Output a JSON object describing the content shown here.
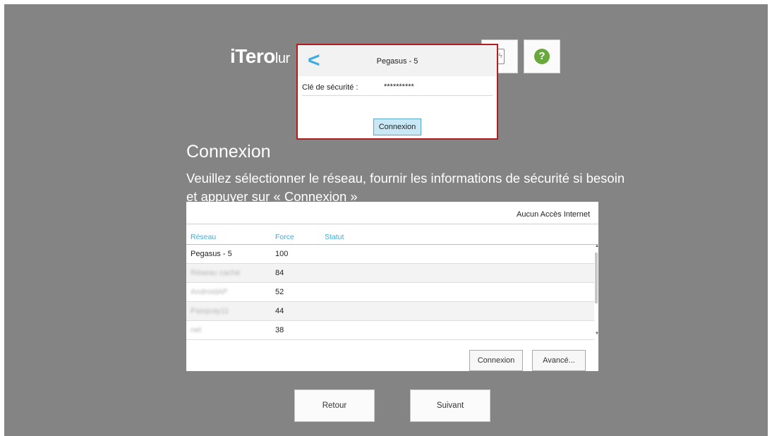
{
  "header": {
    "logo_text": "iTero",
    "logo_suffix": "lur",
    "plug_icon": "plug-icon",
    "help_icon": "question-icon",
    "help_glyph": "?",
    "help_color": "#69a83a"
  },
  "popup": {
    "network_name": "Pegasus - 5",
    "key_label": "Clé de sécurité :",
    "key_value": "**********",
    "connect_label": "Connexion",
    "border_color": "#b01e1e",
    "accent_color": "#3aaee0"
  },
  "main": {
    "title": "Connexion",
    "subtitle": "Veuillez sélectionner le réseau, fournir les informations de sécurité si besoin et appuyer sur « Connexion »"
  },
  "network_panel": {
    "internet_status": "Aucun Accès Internet",
    "columns": [
      "Réseau",
      "Force",
      "Statut"
    ],
    "rows": [
      {
        "name": "Pegasus - 5",
        "force": "100",
        "status": ""
      },
      {
        "name": "Réseau caché",
        "force": "84",
        "status": ""
      },
      {
        "name": "AndroidAP",
        "force": "52",
        "status": ""
      },
      {
        "name": "Pasquay11",
        "force": "44",
        "status": ""
      },
      {
        "name": "net",
        "force": "38",
        "status": ""
      }
    ],
    "connect_label": "Connexion",
    "advanced_label": "Avancé..."
  },
  "footer": {
    "back_label": "Retour",
    "next_label": "Suivant"
  }
}
